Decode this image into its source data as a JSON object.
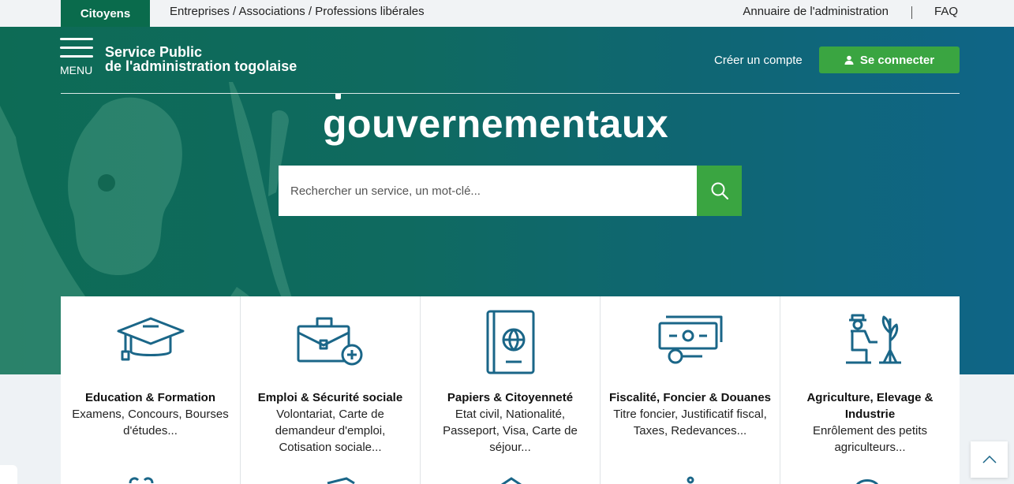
{
  "topbar": {
    "active_tab": "Citoyens",
    "other_tab": "Entreprises / Associations / Professions libérales",
    "annuaire": "Annuaire de l'administration",
    "faq": "FAQ"
  },
  "header": {
    "menu_label": "MENU",
    "title_line1": "Service Public",
    "title_line2": "de l'administration togolaise",
    "create_account": "Créer un compte",
    "login": "Se connecter"
  },
  "hero": {
    "title": "gouvernementaux",
    "search_placeholder": "Rechercher un service, un mot-clé..."
  },
  "cards": [
    {
      "title": "Education & Formation",
      "desc": "Examens, Concours, Bourses d'études...",
      "icon": "graduation-cap-icon"
    },
    {
      "title": "Emploi & Sécurité sociale",
      "desc": "Volontariat, Carte de demandeur d'emploi, Cotisation sociale...",
      "icon": "briefcase-icon"
    },
    {
      "title": "Papiers & Citoyenneté",
      "desc": "Etat civil, Nationalité, Passeport, Visa, Carte de séjour...",
      "icon": "passport-icon"
    },
    {
      "title": "Fiscalité, Foncier & Douanes",
      "desc": "Titre foncier, Justificatif fiscal, Taxes, Redevances...",
      "icon": "money-icon"
    },
    {
      "title": "Agriculture, Elevage & Industrie",
      "desc": "Enrôlement des petits agriculteurs...",
      "icon": "farmer-icon"
    }
  ],
  "colors": {
    "primary_green": "#0a6b4c",
    "accent_green": "#3aa541",
    "icon_blue": "#1a6688"
  }
}
